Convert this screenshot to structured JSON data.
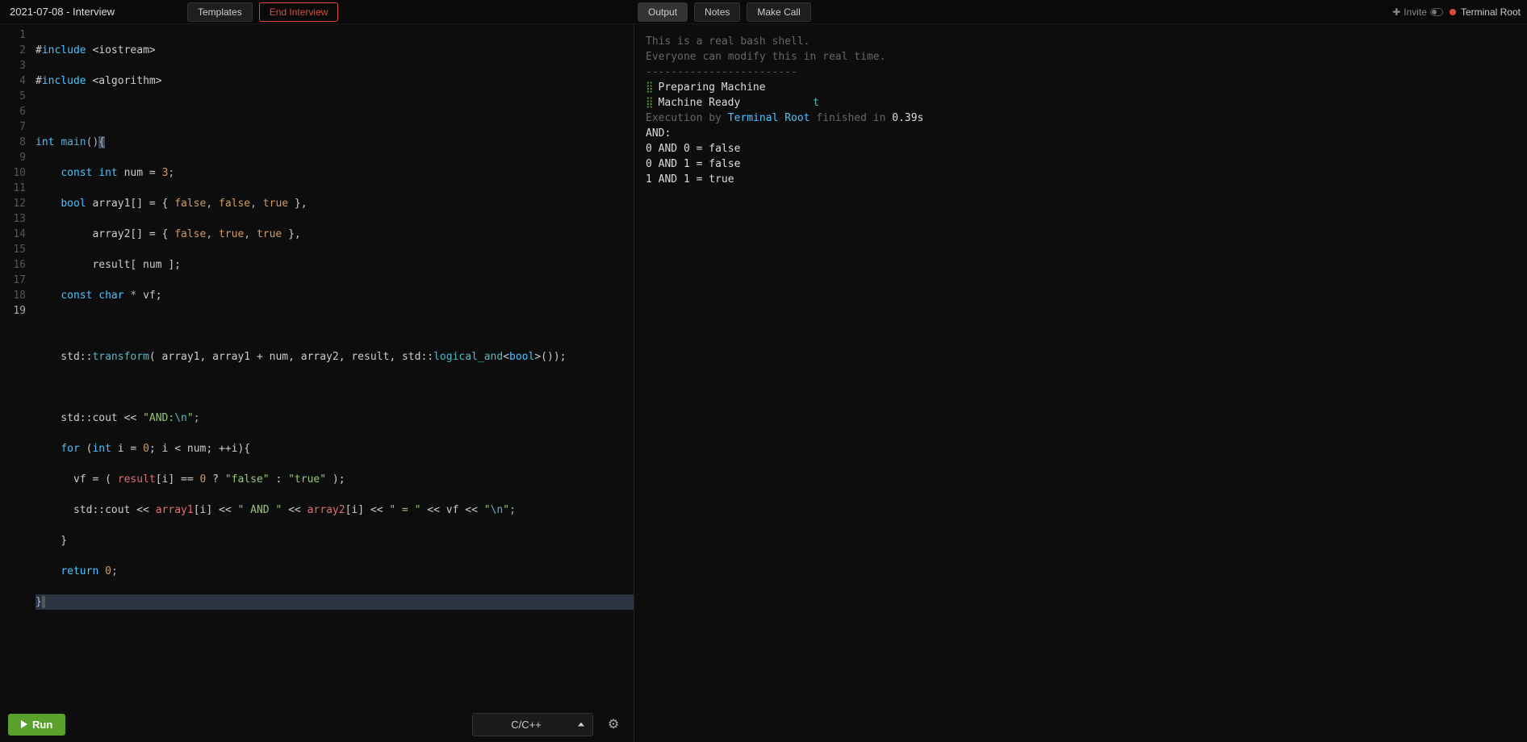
{
  "header": {
    "title": "2021-07-08 - Interview",
    "templates_label": "Templates",
    "end_interview_label": "End Interview",
    "tabs": {
      "output": "Output",
      "notes": "Notes",
      "make_call": "Make Call"
    },
    "invite_label": "Invite",
    "user_name": "Terminal Root"
  },
  "editor": {
    "line_count": 19,
    "current_line": 19,
    "footer": {
      "run_label": "Run",
      "language": "C/C++"
    },
    "code_lines": [
      {
        "n": 1,
        "pre": "#",
        "kw": "include",
        "rest": " <iostream>"
      },
      {
        "n": 2,
        "pre": "#",
        "kw": "include",
        "rest": " <algorithm>"
      }
    ],
    "tokens": {
      "int": "int",
      "main": "main",
      "const": "const",
      "num": "num",
      "eq": " = ",
      "three": "3",
      "bool": "bool",
      "array1": "array1",
      "array2": "array2",
      "result": "result",
      "false": "false",
      "true": "true",
      "char": "char",
      "vf": "vf",
      "std": "std",
      "transform": "transform",
      "logical_and": "logical_and",
      "cout": "cout",
      "and_str": "\"AND:",
      "nl": "\\n",
      "q": "\"",
      "for": "for",
      "i": "i",
      "zero": "0",
      "return": "return",
      "false_str": "\"false\"",
      "true_str": "\"true\"",
      "and_sp": "\" AND \"",
      "eq_sp": "\" = \""
    }
  },
  "output": {
    "intro1": "This is a real bash shell.",
    "intro2": "Everyone can modify this in real time.",
    "sep": "------------------------",
    "preparing": "Preparing Machine",
    "ready": "Machine Ready",
    "t": "t",
    "exec_by": "Execution by ",
    "exec_user": "Terminal Root",
    "exec_mid": " finished in ",
    "exec_time": "0.39s",
    "lines": [
      "AND:",
      "0 AND 0 = false",
      "0 AND 1 = false",
      "1 AND 1 = true"
    ]
  }
}
